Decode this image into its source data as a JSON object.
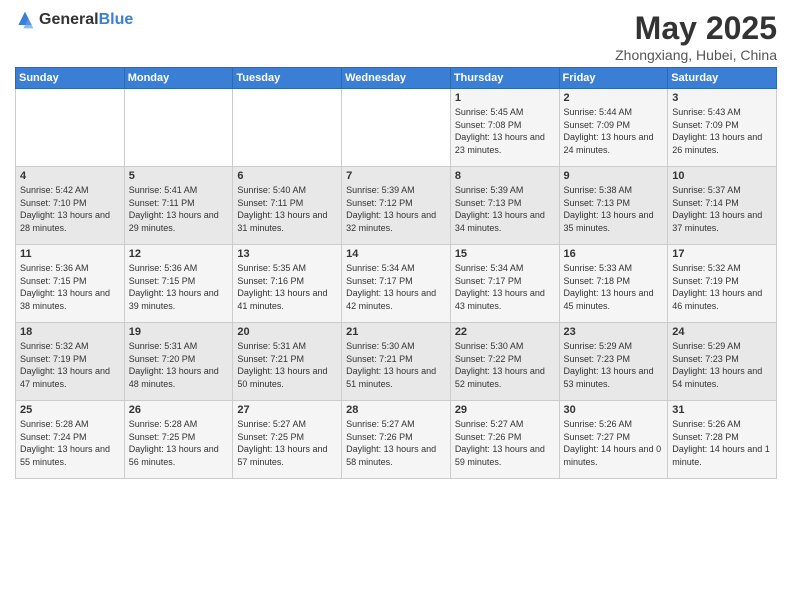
{
  "header": {
    "logo_general": "General",
    "logo_blue": "Blue",
    "month": "May 2025",
    "location": "Zhongxiang, Hubei, China"
  },
  "weekdays": [
    "Sunday",
    "Monday",
    "Tuesday",
    "Wednesday",
    "Thursday",
    "Friday",
    "Saturday"
  ],
  "weeks": [
    [
      {
        "day": "",
        "sunrise": "",
        "sunset": "",
        "daylight": ""
      },
      {
        "day": "",
        "sunrise": "",
        "sunset": "",
        "daylight": ""
      },
      {
        "day": "",
        "sunrise": "",
        "sunset": "",
        "daylight": ""
      },
      {
        "day": "",
        "sunrise": "",
        "sunset": "",
        "daylight": ""
      },
      {
        "day": "1",
        "sunrise": "Sunrise: 5:45 AM",
        "sunset": "Sunset: 7:08 PM",
        "daylight": "Daylight: 13 hours and 23 minutes."
      },
      {
        "day": "2",
        "sunrise": "Sunrise: 5:44 AM",
        "sunset": "Sunset: 7:09 PM",
        "daylight": "Daylight: 13 hours and 24 minutes."
      },
      {
        "day": "3",
        "sunrise": "Sunrise: 5:43 AM",
        "sunset": "Sunset: 7:09 PM",
        "daylight": "Daylight: 13 hours and 26 minutes."
      }
    ],
    [
      {
        "day": "4",
        "sunrise": "Sunrise: 5:42 AM",
        "sunset": "Sunset: 7:10 PM",
        "daylight": "Daylight: 13 hours and 28 minutes."
      },
      {
        "day": "5",
        "sunrise": "Sunrise: 5:41 AM",
        "sunset": "Sunset: 7:11 PM",
        "daylight": "Daylight: 13 hours and 29 minutes."
      },
      {
        "day": "6",
        "sunrise": "Sunrise: 5:40 AM",
        "sunset": "Sunset: 7:11 PM",
        "daylight": "Daylight: 13 hours and 31 minutes."
      },
      {
        "day": "7",
        "sunrise": "Sunrise: 5:39 AM",
        "sunset": "Sunset: 7:12 PM",
        "daylight": "Daylight: 13 hours and 32 minutes."
      },
      {
        "day": "8",
        "sunrise": "Sunrise: 5:39 AM",
        "sunset": "Sunset: 7:13 PM",
        "daylight": "Daylight: 13 hours and 34 minutes."
      },
      {
        "day": "9",
        "sunrise": "Sunrise: 5:38 AM",
        "sunset": "Sunset: 7:13 PM",
        "daylight": "Daylight: 13 hours and 35 minutes."
      },
      {
        "day": "10",
        "sunrise": "Sunrise: 5:37 AM",
        "sunset": "Sunset: 7:14 PM",
        "daylight": "Daylight: 13 hours and 37 minutes."
      }
    ],
    [
      {
        "day": "11",
        "sunrise": "Sunrise: 5:36 AM",
        "sunset": "Sunset: 7:15 PM",
        "daylight": "Daylight: 13 hours and 38 minutes."
      },
      {
        "day": "12",
        "sunrise": "Sunrise: 5:36 AM",
        "sunset": "Sunset: 7:15 PM",
        "daylight": "Daylight: 13 hours and 39 minutes."
      },
      {
        "day": "13",
        "sunrise": "Sunrise: 5:35 AM",
        "sunset": "Sunset: 7:16 PM",
        "daylight": "Daylight: 13 hours and 41 minutes."
      },
      {
        "day": "14",
        "sunrise": "Sunrise: 5:34 AM",
        "sunset": "Sunset: 7:17 PM",
        "daylight": "Daylight: 13 hours and 42 minutes."
      },
      {
        "day": "15",
        "sunrise": "Sunrise: 5:34 AM",
        "sunset": "Sunset: 7:17 PM",
        "daylight": "Daylight: 13 hours and 43 minutes."
      },
      {
        "day": "16",
        "sunrise": "Sunrise: 5:33 AM",
        "sunset": "Sunset: 7:18 PM",
        "daylight": "Daylight: 13 hours and 45 minutes."
      },
      {
        "day": "17",
        "sunrise": "Sunrise: 5:32 AM",
        "sunset": "Sunset: 7:19 PM",
        "daylight": "Daylight: 13 hours and 46 minutes."
      }
    ],
    [
      {
        "day": "18",
        "sunrise": "Sunrise: 5:32 AM",
        "sunset": "Sunset: 7:19 PM",
        "daylight": "Daylight: 13 hours and 47 minutes."
      },
      {
        "day": "19",
        "sunrise": "Sunrise: 5:31 AM",
        "sunset": "Sunset: 7:20 PM",
        "daylight": "Daylight: 13 hours and 48 minutes."
      },
      {
        "day": "20",
        "sunrise": "Sunrise: 5:31 AM",
        "sunset": "Sunset: 7:21 PM",
        "daylight": "Daylight: 13 hours and 50 minutes."
      },
      {
        "day": "21",
        "sunrise": "Sunrise: 5:30 AM",
        "sunset": "Sunset: 7:21 PM",
        "daylight": "Daylight: 13 hours and 51 minutes."
      },
      {
        "day": "22",
        "sunrise": "Sunrise: 5:30 AM",
        "sunset": "Sunset: 7:22 PM",
        "daylight": "Daylight: 13 hours and 52 minutes."
      },
      {
        "day": "23",
        "sunrise": "Sunrise: 5:29 AM",
        "sunset": "Sunset: 7:23 PM",
        "daylight": "Daylight: 13 hours and 53 minutes."
      },
      {
        "day": "24",
        "sunrise": "Sunrise: 5:29 AM",
        "sunset": "Sunset: 7:23 PM",
        "daylight": "Daylight: 13 hours and 54 minutes."
      }
    ],
    [
      {
        "day": "25",
        "sunrise": "Sunrise: 5:28 AM",
        "sunset": "Sunset: 7:24 PM",
        "daylight": "Daylight: 13 hours and 55 minutes."
      },
      {
        "day": "26",
        "sunrise": "Sunrise: 5:28 AM",
        "sunset": "Sunset: 7:25 PM",
        "daylight": "Daylight: 13 hours and 56 minutes."
      },
      {
        "day": "27",
        "sunrise": "Sunrise: 5:27 AM",
        "sunset": "Sunset: 7:25 PM",
        "daylight": "Daylight: 13 hours and 57 minutes."
      },
      {
        "day": "28",
        "sunrise": "Sunrise: 5:27 AM",
        "sunset": "Sunset: 7:26 PM",
        "daylight": "Daylight: 13 hours and 58 minutes."
      },
      {
        "day": "29",
        "sunrise": "Sunrise: 5:27 AM",
        "sunset": "Sunset: 7:26 PM",
        "daylight": "Daylight: 13 hours and 59 minutes."
      },
      {
        "day": "30",
        "sunrise": "Sunrise: 5:26 AM",
        "sunset": "Sunset: 7:27 PM",
        "daylight": "Daylight: 14 hours and 0 minutes."
      },
      {
        "day": "31",
        "sunrise": "Sunrise: 5:26 AM",
        "sunset": "Sunset: 7:28 PM",
        "daylight": "Daylight: 14 hours and 1 minute."
      }
    ]
  ]
}
